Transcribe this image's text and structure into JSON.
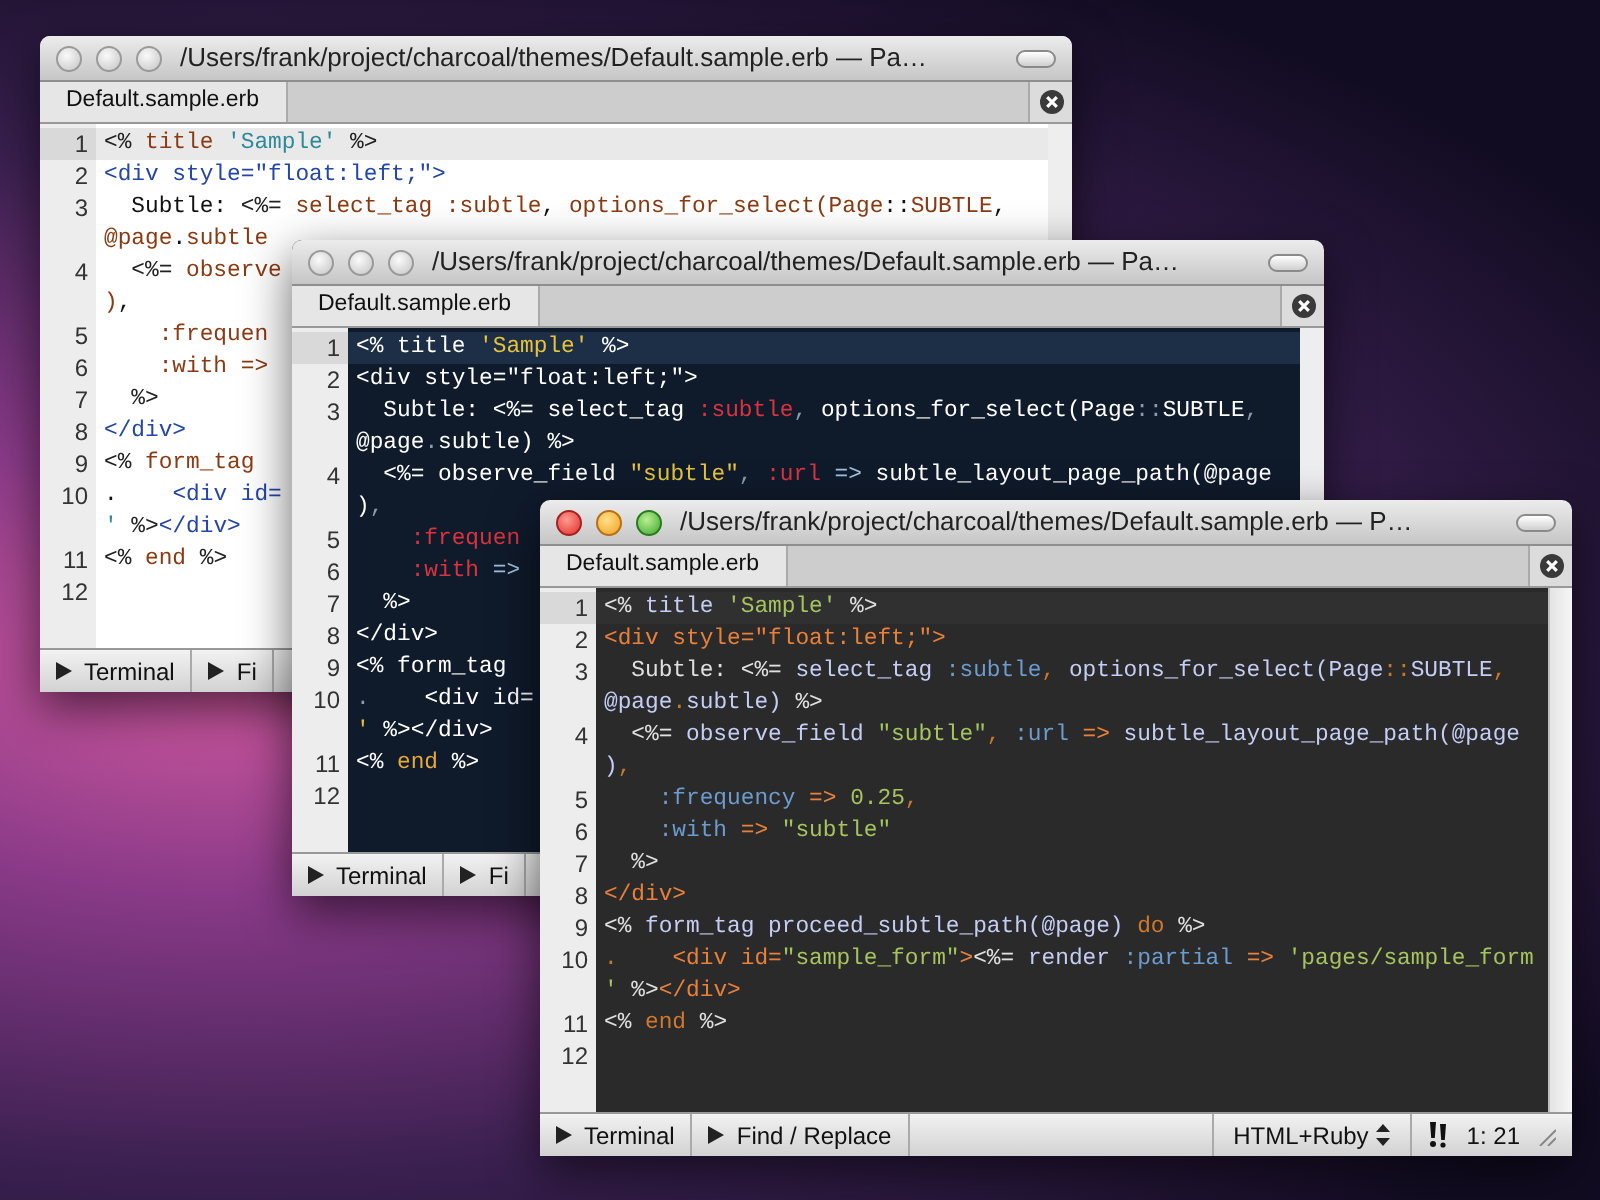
{
  "windows": [
    {
      "active": false,
      "kind": "light",
      "title": "/Users/frank/project/charcoal/themes/Default.sample.erb — Pa…",
      "tabs": [
        {
          "label": "Default.sample.erb",
          "selected": true
        }
      ],
      "lines": [
        {
          "number": "1",
          "current": true,
          "rows": [
            {
              "tokens": [
                {
                  "kind": "erb",
                  "text": "<% "
                },
                {
                  "kind": "ruby",
                  "text": "title "
                },
                {
                  "kind": "string",
                  "text": "'Sample'"
                },
                {
                  "kind": "erb",
                  "text": " %>"
                }
              ]
            }
          ]
        },
        {
          "number": "2",
          "current": false,
          "rows": [
            {
              "tokens": [
                {
                  "kind": "tag",
                  "text": "<div style=\"float:left;\">"
                }
              ]
            }
          ]
        },
        {
          "number": "3",
          "current": false,
          "rows": [
            {
              "tokens": [
                {
                  "kind": "text",
                  "text": "  Subtle: "
                },
                {
                  "kind": "erb",
                  "text": "<%= "
                },
                {
                  "kind": "ruby",
                  "text": "select_tag "
                },
                {
                  "kind": "symbol",
                  "text": ":subtle"
                },
                {
                  "kind": "punct",
                  "text": ", "
                },
                {
                  "kind": "ruby",
                  "text": "options_for_select(Page"
                },
                {
                  "kind": "punct",
                  "text": "::"
                },
                {
                  "kind": "ruby",
                  "text": "SUBTLE"
                },
                {
                  "kind": "punct",
                  "text": ","
                }
              ]
            },
            {
              "tokens": [
                {
                  "kind": "ruby",
                  "text": "@page"
                },
                {
                  "kind": "punct",
                  "text": "."
                },
                {
                  "kind": "ruby",
                  "text": "subtle"
                }
              ]
            }
          ]
        },
        {
          "number": "4",
          "current": false,
          "rows": [
            {
              "tokens": [
                {
                  "kind": "erb",
                  "text": "  <%= "
                },
                {
                  "kind": "ruby",
                  "text": "observe"
                }
              ]
            },
            {
              "tokens": [
                {
                  "kind": "ruby",
                  "text": ")"
                },
                {
                  "kind": "punct",
                  "text": ","
                }
              ]
            }
          ]
        },
        {
          "number": "5",
          "current": false,
          "rows": [
            {
              "tokens": [
                {
                  "kind": "symbol",
                  "text": "    :frequen"
                }
              ]
            }
          ]
        },
        {
          "number": "6",
          "current": false,
          "rows": [
            {
              "tokens": [
                {
                  "kind": "symbol",
                  "text": "    :with "
                },
                {
                  "kind": "op",
                  "text": "=>"
                }
              ]
            }
          ]
        },
        {
          "number": "7",
          "current": false,
          "rows": [
            {
              "tokens": [
                {
                  "kind": "erb",
                  "text": "  %>"
                }
              ]
            }
          ]
        },
        {
          "number": "8",
          "current": false,
          "rows": [
            {
              "tokens": [
                {
                  "kind": "tag",
                  "text": "</div>"
                }
              ]
            }
          ]
        },
        {
          "number": "9",
          "current": false,
          "rows": [
            {
              "tokens": [
                {
                  "kind": "erb",
                  "text": "<% "
                },
                {
                  "kind": "ruby",
                  "text": "form_tag"
                }
              ]
            }
          ]
        },
        {
          "number": "10",
          "current": false,
          "rows": [
            {
              "tokens": [
                {
                  "kind": "punct",
                  "text": ".    "
                },
                {
                  "kind": "tag",
                  "text": "<div id="
                }
              ]
            },
            {
              "tokens": [
                {
                  "kind": "string",
                  "text": "'"
                },
                {
                  "kind": "erb",
                  "text": " %>"
                },
                {
                  "kind": "tag",
                  "text": "</div>"
                }
              ]
            }
          ]
        },
        {
          "number": "11",
          "current": false,
          "rows": [
            {
              "tokens": [
                {
                  "kind": "erb",
                  "text": "<% "
                },
                {
                  "kind": "keyword",
                  "text": "end"
                },
                {
                  "kind": "erb",
                  "text": " %>"
                }
              ]
            }
          ]
        },
        {
          "number": "12",
          "current": false
        }
      ],
      "status": {
        "buttons": [
          "Terminal",
          "Fi"
        ]
      }
    },
    {
      "active": false,
      "kind": "midnight",
      "title": "/Users/frank/project/charcoal/themes/Default.sample.erb — Pa…",
      "tabs": [
        {
          "label": "Default.sample.erb",
          "selected": true
        }
      ],
      "lines": [
        {
          "number": "1",
          "current": true,
          "rows": [
            {
              "tokens": [
                {
                  "kind": "erb",
                  "text": "<% "
                },
                {
                  "kind": "ruby",
                  "text": "title "
                },
                {
                  "kind": "string",
                  "text": "'Sample'"
                },
                {
                  "kind": "erb",
                  "text": " %>"
                }
              ]
            }
          ]
        },
        {
          "number": "2",
          "current": false,
          "rows": [
            {
              "tokens": [
                {
                  "kind": "tag",
                  "text": "<div style=\"float:left;\">"
                }
              ]
            }
          ]
        },
        {
          "number": "3",
          "current": false,
          "rows": [
            {
              "tokens": [
                {
                  "kind": "text",
                  "text": "  Subtle: "
                },
                {
                  "kind": "erb",
                  "text": "<%= "
                },
                {
                  "kind": "ruby",
                  "text": "select_tag "
                },
                {
                  "kind": "symbol",
                  "text": ":subtle"
                },
                {
                  "kind": "punct",
                  "text": ", "
                },
                {
                  "kind": "ruby",
                  "text": "options_for_select(Page"
                },
                {
                  "kind": "punct",
                  "text": "::"
                },
                {
                  "kind": "ruby",
                  "text": "SUBTLE"
                },
                {
                  "kind": "punct",
                  "text": ","
                }
              ]
            },
            {
              "tokens": [
                {
                  "kind": "ruby",
                  "text": "@page"
                },
                {
                  "kind": "punct",
                  "text": "."
                },
                {
                  "kind": "ruby",
                  "text": "subtle) "
                },
                {
                  "kind": "erb",
                  "text": "%>"
                }
              ]
            }
          ]
        },
        {
          "number": "4",
          "current": false,
          "rows": [
            {
              "tokens": [
                {
                  "kind": "erb",
                  "text": "  <%= "
                },
                {
                  "kind": "ruby",
                  "text": "observe_field "
                },
                {
                  "kind": "string",
                  "text": "\"subtle\""
                },
                {
                  "kind": "punct",
                  "text": ", "
                },
                {
                  "kind": "symbol",
                  "text": ":url "
                },
                {
                  "kind": "op",
                  "text": "=> "
                },
                {
                  "kind": "ruby",
                  "text": "subtle_layout_page_path(@page"
                }
              ]
            },
            {
              "tokens": [
                {
                  "kind": "ruby",
                  "text": ")"
                },
                {
                  "kind": "punct",
                  "text": ","
                }
              ]
            }
          ]
        },
        {
          "number": "5",
          "current": false,
          "rows": [
            {
              "tokens": [
                {
                  "kind": "symbol",
                  "text": "    :frequen"
                }
              ]
            }
          ]
        },
        {
          "number": "6",
          "current": false,
          "rows": [
            {
              "tokens": [
                {
                  "kind": "symbol",
                  "text": "    :with "
                },
                {
                  "kind": "op",
                  "text": "=>"
                }
              ]
            }
          ]
        },
        {
          "number": "7",
          "current": false,
          "rows": [
            {
              "tokens": [
                {
                  "kind": "erb",
                  "text": "  %>"
                }
              ]
            }
          ]
        },
        {
          "number": "8",
          "current": false,
          "rows": [
            {
              "tokens": [
                {
                  "kind": "tag",
                  "text": "</div>"
                }
              ]
            }
          ]
        },
        {
          "number": "9",
          "current": false,
          "rows": [
            {
              "tokens": [
                {
                  "kind": "erb",
                  "text": "<% "
                },
                {
                  "kind": "ruby",
                  "text": "form_tag"
                }
              ]
            }
          ]
        },
        {
          "number": "10",
          "current": false,
          "rows": [
            {
              "tokens": [
                {
                  "kind": "punct",
                  "text": ".    "
                },
                {
                  "kind": "tag",
                  "text": "<div id="
                }
              ]
            },
            {
              "tokens": [
                {
                  "kind": "string",
                  "text": "'"
                },
                {
                  "kind": "erb",
                  "text": " %>"
                },
                {
                  "kind": "tag",
                  "text": "</div>"
                }
              ]
            }
          ]
        },
        {
          "number": "11",
          "current": false,
          "rows": [
            {
              "tokens": [
                {
                  "kind": "erb",
                  "text": "<% "
                },
                {
                  "kind": "keyword",
                  "text": "end"
                },
                {
                  "kind": "erb",
                  "text": " %>"
                }
              ]
            }
          ]
        },
        {
          "number": "12",
          "current": false
        }
      ],
      "status": {
        "buttons": [
          "Terminal",
          "Fi"
        ]
      }
    },
    {
      "active": true,
      "kind": "charcoal",
      "title": "/Users/frank/project/charcoal/themes/Default.sample.erb — P…",
      "tabs": [
        {
          "label": "Default.sample.erb",
          "selected": true
        }
      ],
      "lines": [
        {
          "number": "1",
          "current": true,
          "rows": [
            {
              "tokens": [
                {
                  "kind": "erb",
                  "text": "<% "
                },
                {
                  "kind": "ruby",
                  "text": "title "
                },
                {
                  "kind": "string",
                  "text": "'Sample'"
                },
                {
                  "kind": "erb",
                  "text": " %>"
                }
              ]
            }
          ]
        },
        {
          "number": "2",
          "current": false,
          "rows": [
            {
              "tokens": [
                {
                  "kind": "tag",
                  "text": "<div style=\"float:left;\">"
                }
              ]
            }
          ]
        },
        {
          "number": "3",
          "current": false,
          "rows": [
            {
              "tokens": [
                {
                  "kind": "text",
                  "text": "  Subtle: "
                },
                {
                  "kind": "erb",
                  "text": "<%= "
                },
                {
                  "kind": "ruby",
                  "text": "select_tag "
                },
                {
                  "kind": "symbol",
                  "text": ":subtle"
                },
                {
                  "kind": "punct",
                  "text": ", "
                },
                {
                  "kind": "ruby",
                  "text": "options_for_select(Page"
                },
                {
                  "kind": "punct",
                  "text": "::"
                },
                {
                  "kind": "ruby",
                  "text": "SUBTLE"
                },
                {
                  "kind": "punct",
                  "text": ","
                }
              ]
            },
            {
              "tokens": [
                {
                  "kind": "ruby",
                  "text": "@page"
                },
                {
                  "kind": "punct",
                  "text": "."
                },
                {
                  "kind": "ruby",
                  "text": "subtle) "
                },
                {
                  "kind": "erb",
                  "text": "%>"
                }
              ]
            }
          ]
        },
        {
          "number": "4",
          "current": false,
          "rows": [
            {
              "tokens": [
                {
                  "kind": "erb",
                  "text": "  <%= "
                },
                {
                  "kind": "ruby",
                  "text": "observe_field "
                },
                {
                  "kind": "string",
                  "text": "\"subtle\""
                },
                {
                  "kind": "punct",
                  "text": ", "
                },
                {
                  "kind": "symbol",
                  "text": ":url "
                },
                {
                  "kind": "op",
                  "text": "=> "
                },
                {
                  "kind": "ruby",
                  "text": "subtle_layout_page_path(@page"
                }
              ]
            },
            {
              "tokens": [
                {
                  "kind": "ruby",
                  "text": ")"
                },
                {
                  "kind": "punct",
                  "text": ","
                }
              ]
            }
          ]
        },
        {
          "number": "5",
          "current": false,
          "rows": [
            {
              "tokens": [
                {
                  "kind": "symbol",
                  "text": "    :frequency "
                },
                {
                  "kind": "op",
                  "text": "=> "
                },
                {
                  "kind": "number",
                  "text": "0.25"
                },
                {
                  "kind": "punct",
                  "text": ","
                }
              ]
            }
          ]
        },
        {
          "number": "6",
          "current": false,
          "rows": [
            {
              "tokens": [
                {
                  "kind": "symbol",
                  "text": "    :with "
                },
                {
                  "kind": "op",
                  "text": "=> "
                },
                {
                  "kind": "string",
                  "text": "\"subtle\""
                }
              ]
            }
          ]
        },
        {
          "number": "7",
          "current": false,
          "rows": [
            {
              "tokens": [
                {
                  "kind": "erb",
                  "text": "  %>"
                }
              ]
            }
          ]
        },
        {
          "number": "8",
          "current": false,
          "rows": [
            {
              "tokens": [
                {
                  "kind": "tag",
                  "text": "</div>"
                }
              ]
            }
          ]
        },
        {
          "number": "9",
          "current": false,
          "rows": [
            {
              "tokens": [
                {
                  "kind": "erb",
                  "text": "<% "
                },
                {
                  "kind": "ruby",
                  "text": "form_tag proceed_subtle_path(@page) "
                },
                {
                  "kind": "keyword",
                  "text": "do"
                },
                {
                  "kind": "erb",
                  "text": " %>"
                }
              ]
            }
          ]
        },
        {
          "number": "10",
          "current": false,
          "rows": [
            {
              "tokens": [
                {
                  "kind": "punct",
                  "text": ".    "
                },
                {
                  "kind": "tag",
                  "text": "<div id="
                },
                {
                  "kind": "string",
                  "text": "\"sample_form\""
                },
                {
                  "kind": "tag",
                  "text": ">"
                },
                {
                  "kind": "erb",
                  "text": "<%= "
                },
                {
                  "kind": "ruby",
                  "text": "render "
                },
                {
                  "kind": "symbol",
                  "text": ":partial "
                },
                {
                  "kind": "op",
                  "text": "=> "
                },
                {
                  "kind": "string",
                  "text": "'pages/sample_form"
                }
              ]
            },
            {
              "tokens": [
                {
                  "kind": "string",
                  "text": "'"
                },
                {
                  "kind": "erb",
                  "text": " %>"
                },
                {
                  "kind": "tag",
                  "text": "</div>"
                }
              ]
            }
          ]
        },
        {
          "number": "11",
          "current": false,
          "rows": [
            {
              "tokens": [
                {
                  "kind": "erb",
                  "text": "<% "
                },
                {
                  "kind": "keyword",
                  "text": "end"
                },
                {
                  "kind": "erb",
                  "text": " %>"
                }
              ]
            }
          ]
        },
        {
          "number": "12",
          "current": false
        }
      ],
      "status": {
        "buttons": [
          "Terminal",
          "Find / Replace"
        ],
        "syntax": "HTML+Ruby",
        "position": "1: 21"
      }
    }
  ]
}
